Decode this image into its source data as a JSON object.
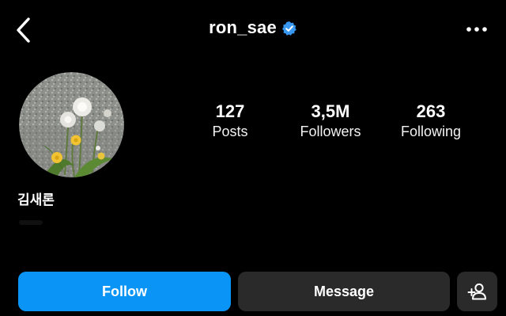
{
  "header": {
    "username": "ron_sae",
    "back_icon": "chevron-left-icon",
    "verified_icon": "verified-badge-icon",
    "more_icon": "more-horizontal-icon",
    "verified_color": "#3897f0"
  },
  "profile": {
    "avatar": "dandelion-photo-avatar",
    "display_name": "김새론"
  },
  "stats": [
    {
      "value": "127",
      "label": "Posts"
    },
    {
      "value": "3,5M",
      "label": "Followers"
    },
    {
      "value": "263",
      "label": "Following"
    }
  ],
  "actions": {
    "follow_label": "Follow",
    "message_label": "Message",
    "add_user_icon": "add-user-icon",
    "follow_color": "#0a95f6",
    "secondary_color": "#2a2a2a"
  }
}
